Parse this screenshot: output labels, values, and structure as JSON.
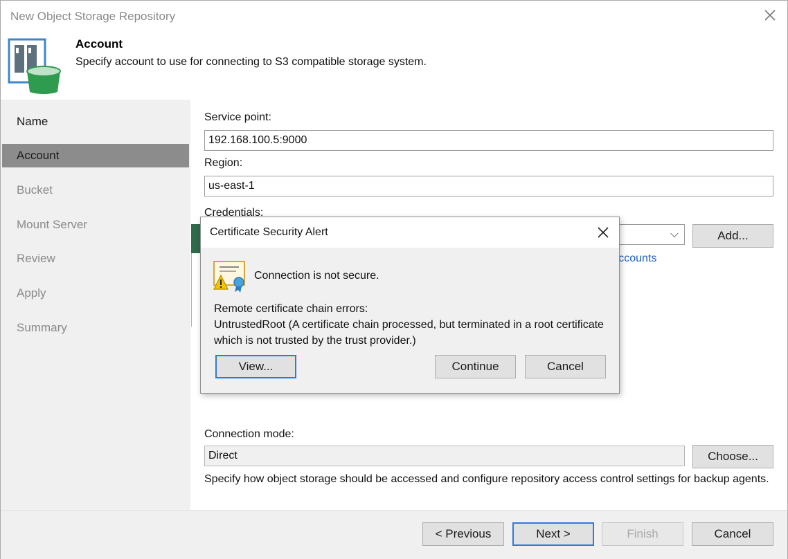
{
  "window": {
    "title": "New Object Storage Repository",
    "close_glyph": "✕"
  },
  "header": {
    "title": "Account",
    "description": "Specify account to use for connecting to S3 compatible storage system.",
    "icon": "object-storage-repository-icon"
  },
  "sidebar": {
    "items": [
      {
        "label": "Name"
      },
      {
        "label": "Account"
      },
      {
        "label": "Bucket"
      },
      {
        "label": "Mount Server"
      },
      {
        "label": "Review"
      },
      {
        "label": "Apply"
      },
      {
        "label": "Summary"
      }
    ],
    "active_index": 1
  },
  "form": {
    "service_point_label": "Service point:",
    "service_point_value": "192.168.100.5:9000",
    "region_label": "Region:",
    "region_value": "us-east-1",
    "credentials_label": "Credentials:",
    "credentials_dropdown_glyph": "⌵",
    "add_button": "Add...",
    "manage_accounts_link_visible": "d accounts",
    "connection_mode_label": "Connection mode:",
    "connection_mode_value": "Direct",
    "choose_button": "Choose...",
    "connection_mode_help": "Specify how object storage should be accessed and configure repository access control settings for backup agents."
  },
  "footer": {
    "previous": "< Previous",
    "next": "Next >",
    "finish": "Finish",
    "cancel": "Cancel"
  },
  "dialog": {
    "title": "Certificate Security Alert",
    "close_glyph": "✕",
    "message": "Connection is not secure.",
    "errors_heading": "Remote certificate chain errors:",
    "error_detail": "UntrustedRoot (A certificate chain processed, but terminated in a root certificate which is not trusted by the trust provider.)",
    "view_button": "View...",
    "continue_button": "Continue",
    "cancel_button": "Cancel",
    "icon": "certificate-warning-icon"
  },
  "colors": {
    "sidebar_bg": "#f0f0f0",
    "sidebar_active": "#8c8c8c",
    "link": "#1f5fbf",
    "default_button_border": "#2e7bd6",
    "brand_green": "#2e9b4f"
  }
}
